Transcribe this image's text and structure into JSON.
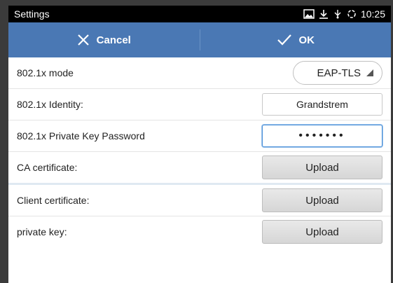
{
  "status": {
    "title": "Settings",
    "time": "10:25"
  },
  "actions": {
    "cancel": "Cancel",
    "ok": "OK"
  },
  "rows": {
    "mode": {
      "label": "802.1x mode",
      "value": "EAP-TLS"
    },
    "identity": {
      "label": "802.1x Identity:",
      "value": "Grandstrem"
    },
    "password": {
      "label": "802.1x Private Key Password",
      "value": "•••••••"
    },
    "ca": {
      "label": "CA certificate:",
      "button": "Upload"
    },
    "client": {
      "label": "Client certificate:",
      "button": "Upload"
    },
    "private": {
      "label": "private key:",
      "button": "Upload"
    }
  }
}
